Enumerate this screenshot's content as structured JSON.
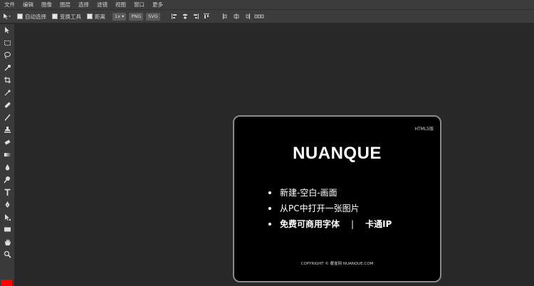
{
  "menu": [
    "文件",
    "编辑",
    "图像",
    "图层",
    "选择",
    "滤镜",
    "视图",
    "窗口",
    "更多"
  ],
  "options": {
    "auto_select": "自动选择",
    "transform_controls": "变换工具",
    "distance": "距离",
    "zoom": "1x",
    "png": "PNG",
    "svg": "SVG"
  },
  "tools": [
    "move-icon",
    "marquee-icon",
    "lasso-icon",
    "quick-select-icon",
    "crop-icon",
    "eyedropper-icon",
    "healing-icon",
    "brush-icon",
    "stamp-icon",
    "eraser-icon",
    "gradient-icon",
    "blur-icon",
    "dodge-icon",
    "type-icon",
    "pen-icon",
    "path-select-icon",
    "rectangle-icon",
    "hand-icon",
    "zoom-icon"
  ],
  "colors": {
    "foreground": "#ff0000",
    "accent": "#ffffff"
  },
  "welcome": {
    "badge": "HTML5版",
    "logo": "NUANQUE",
    "new_blank": "新建-空白-画面",
    "open_from_pc": "从PC中打开一张图片",
    "free_fonts": "免费可商用字体",
    "separator": "|",
    "cartoon_ip": "卡通IP",
    "copyright": "COPYRIGHT © 暖雀网 NUANQUE.COM"
  }
}
